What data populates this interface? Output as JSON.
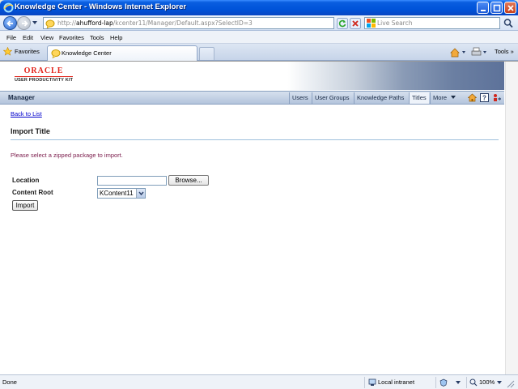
{
  "window": {
    "title": "Knowledge Center - Windows Internet Explorer"
  },
  "address_bar": {
    "url_prefix": "http://",
    "url_host": "ahufford-lap",
    "url_path": "/kcenter11/Manager/Default.aspx?SelectID=3"
  },
  "search": {
    "placeholder": "Live Search"
  },
  "menu": {
    "items": [
      "File",
      "Edit",
      "View",
      "Favorites",
      "Tools",
      "Help"
    ]
  },
  "tabbar": {
    "favorites_label": "Favorites",
    "tab_label": "Knowledge Center",
    "tools_label": "Tools"
  },
  "banner": {
    "logo_word": "ORACLE",
    "logo_sub": "USER PRODUCTIVITY KIT"
  },
  "appnav": {
    "section": "Manager",
    "links": [
      "Users",
      "User Groups",
      "Knowledge Paths",
      "Titles",
      "More"
    ],
    "active_link": "Titles"
  },
  "content": {
    "back_link": "Back to List",
    "title": "Import Title",
    "instructions": "Please select a zipped package to import.",
    "location_label": "Location",
    "location_value": "",
    "browse_label": "Browse...",
    "content_root_label": "Content Root",
    "content_root_value": "KContent11",
    "import_label": "Import"
  },
  "status": {
    "left_text": "Done",
    "zone": "Local intranet",
    "zoom": "100%"
  }
}
